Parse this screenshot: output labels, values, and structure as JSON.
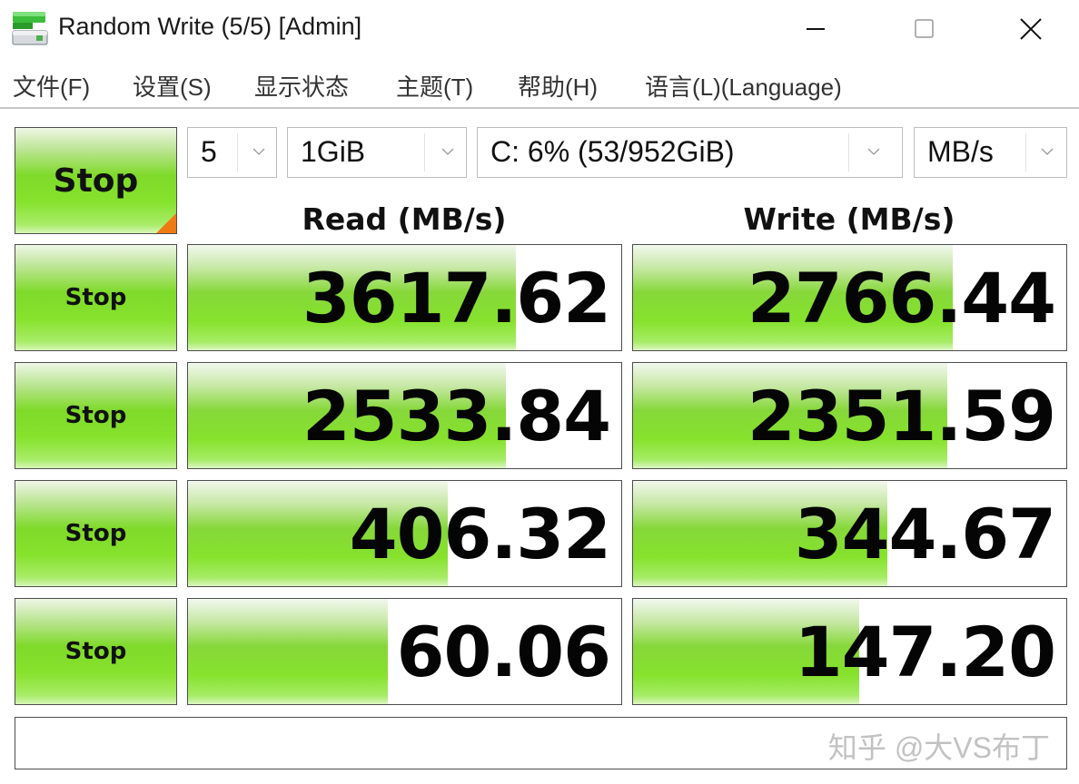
{
  "window": {
    "title": "Random Write (5/5) [Admin]",
    "controls": {
      "minimize": "minimize-icon",
      "maximize": "maximize-icon",
      "close": "close-icon"
    }
  },
  "menu": {
    "items": [
      {
        "label": "文件(F)"
      },
      {
        "label": "设置(S)"
      },
      {
        "label": "显示状态"
      },
      {
        "label": "主题(T)"
      },
      {
        "label": "帮助(H)"
      },
      {
        "label": "语言(L)(Language)"
      }
    ]
  },
  "toolbar": {
    "all_button_label": "Stop",
    "count": {
      "value": "5"
    },
    "size": {
      "value": "1GiB"
    },
    "drive": {
      "value": "C: 6% (53/952GiB)"
    },
    "unit": {
      "value": "MB/s"
    }
  },
  "columns": {
    "read": "Read (MB/s)",
    "write": "Write (MB/s)"
  },
  "rows": [
    {
      "button_label": "Stop",
      "read": "3617.62",
      "read_fill": 0.756,
      "write": "2766.44",
      "write_fill": 0.737
    },
    {
      "button_label": "Stop",
      "read": "2533.84",
      "read_fill": 0.733,
      "write": "2351.59",
      "write_fill": 0.725
    },
    {
      "button_label": "Stop",
      "read": "406.32",
      "read_fill": 0.599,
      "write": "344.67",
      "write_fill": 0.586
    },
    {
      "button_label": "Stop",
      "read": "60.06",
      "read_fill": 0.462,
      "write": "147.20",
      "write_fill": 0.521
    }
  ],
  "status": {
    "text": "",
    "watermark": "知乎 @大VS布丁"
  },
  "colors": {
    "accent_green": "#86e22c",
    "corner_orange": "#f07a12"
  }
}
